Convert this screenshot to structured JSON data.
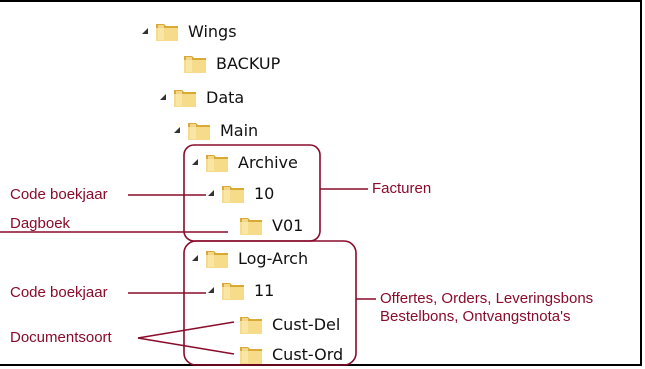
{
  "tree": [
    {
      "label": "Wings",
      "expanded": true,
      "depth": 0
    },
    {
      "label": "BACKUP",
      "expanded": false,
      "depth": 1
    },
    {
      "label": "Data",
      "expanded": true,
      "depth": 1
    },
    {
      "label": "Main",
      "expanded": true,
      "depth": 2
    },
    {
      "label": "Archive",
      "expanded": true,
      "depth": 3
    },
    {
      "label": "10",
      "expanded": true,
      "depth": 4
    },
    {
      "label": "V01",
      "expanded": false,
      "depth": 5
    },
    {
      "label": "Log-Arch",
      "expanded": true,
      "depth": 3
    },
    {
      "label": "11",
      "expanded": true,
      "depth": 4
    },
    {
      "label": "Cust-Del",
      "expanded": false,
      "depth": 5
    },
    {
      "label": "Cust-Ord",
      "expanded": false,
      "depth": 5
    }
  ],
  "annotations": {
    "code_boekjaar_1": "Code boekjaar",
    "dagboek": "Dagboek",
    "facturen": "Facturen",
    "code_boekjaar_2": "Code boekjaar",
    "offertes_line1": "Offertes, Orders, Leveringsbons",
    "offertes_line2": "Bestelbons, Ontvangstnota's",
    "documentsoort": "Documentsoort"
  },
  "colors": {
    "annotation": "#8a0b2b",
    "folder_light": "#f6dc8a",
    "folder_dark": "#d9a935"
  }
}
